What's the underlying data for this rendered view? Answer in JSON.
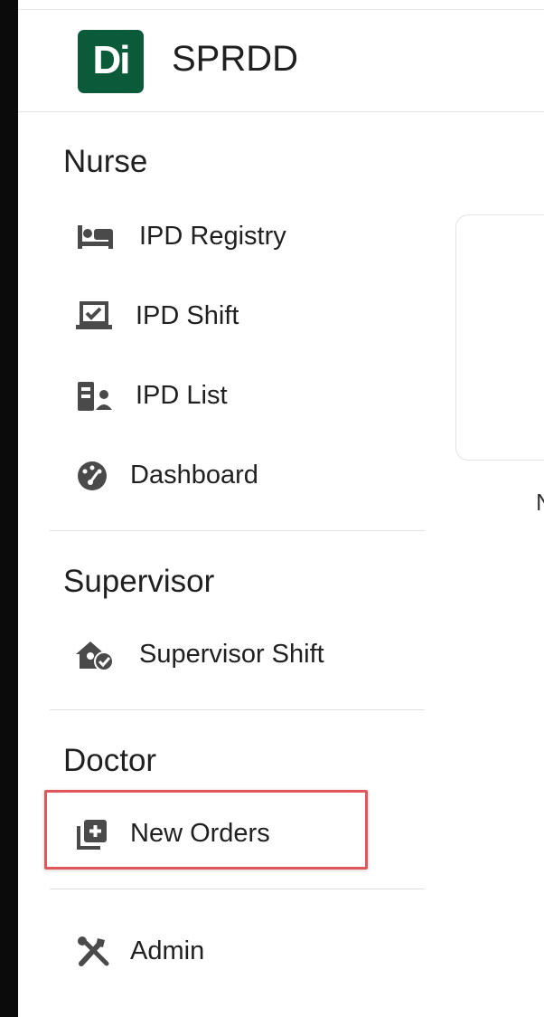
{
  "app": {
    "logo_text": "Di",
    "title": "SPRDD",
    "brand_color": "#0b5a3a"
  },
  "sections": {
    "nurse": {
      "title": "Nurse",
      "items": [
        {
          "label": "IPD Registry",
          "icon": "bed-icon"
        },
        {
          "label": "IPD Shift",
          "icon": "laptop-check-icon"
        },
        {
          "label": "IPD List",
          "icon": "patient-list-icon"
        },
        {
          "label": "Dashboard",
          "icon": "dashboard-gauge-icon"
        }
      ]
    },
    "supervisor": {
      "title": "Supervisor",
      "items": [
        {
          "label": "Supervisor Shift",
          "icon": "home-user-check-icon"
        }
      ]
    },
    "doctor": {
      "title": "Doctor",
      "items": [
        {
          "label": "New Orders",
          "icon": "add-library-icon"
        }
      ]
    },
    "admin": {
      "items": [
        {
          "label": "Admin",
          "icon": "tools-icon"
        }
      ]
    }
  },
  "main": {
    "card_caption_partial": "N"
  },
  "colors": {
    "highlight_border": "#e0565b",
    "icon_color": "#4a4a4a"
  }
}
